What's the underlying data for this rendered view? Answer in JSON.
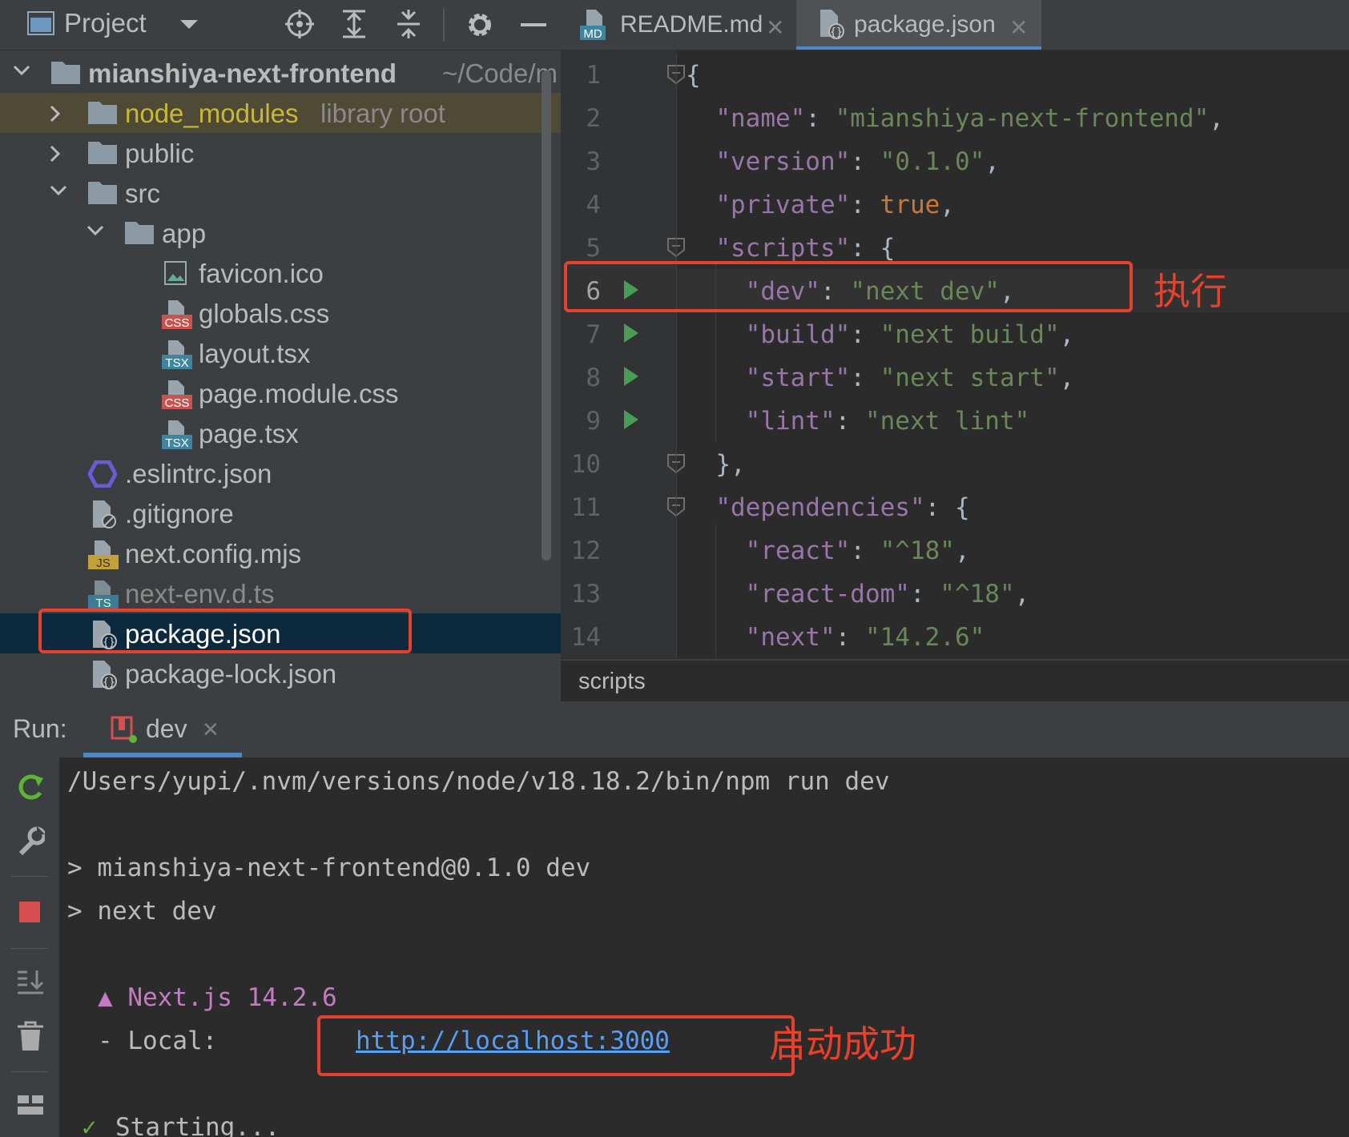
{
  "project_panel": {
    "title": "Project",
    "tree": {
      "root": {
        "label": "mianshiya-next-frontend",
        "path_hint": "~/Code/m"
      },
      "node_modules": {
        "label": "node_modules",
        "suffix": "library root"
      },
      "public": {
        "label": "public"
      },
      "src": {
        "label": "src"
      },
      "app": {
        "label": "app"
      },
      "files": [
        {
          "label": "favicon.ico",
          "badge": ""
        },
        {
          "label": "globals.css",
          "badge": "CSS"
        },
        {
          "label": "layout.tsx",
          "badge": "TSX"
        },
        {
          "label": "page.module.css",
          "badge": "CSS"
        },
        {
          "label": "page.tsx",
          "badge": "TSX"
        }
      ],
      "root_files": [
        {
          "label": ".eslintrc.json",
          "badge": ""
        },
        {
          "label": ".gitignore",
          "badge": ""
        },
        {
          "label": "next.config.mjs",
          "badge": "JS"
        },
        {
          "label": "next-env.d.ts",
          "badge": "TS"
        },
        {
          "label": "package.json",
          "badge": ""
        },
        {
          "label": "package-lock.json",
          "badge": ""
        }
      ]
    }
  },
  "editor": {
    "tabs": [
      {
        "label": "README.md",
        "badge": "MD"
      },
      {
        "label": "package.json",
        "badge": ""
      }
    ],
    "lines": [
      {
        "n": "1",
        "t": [
          "p:{"
        ]
      },
      {
        "n": "2",
        "t": [
          "k:  \"name\"",
          "p:: ",
          "s:\"mianshiya-next-frontend\"",
          "p:,"
        ]
      },
      {
        "n": "3",
        "t": [
          "k:  \"version\"",
          "p:: ",
          "s:\"0.1.0\"",
          "p:,"
        ]
      },
      {
        "n": "4",
        "t": [
          "k:  \"private\"",
          "p:: ",
          "kw:true",
          "p:,"
        ]
      },
      {
        "n": "5",
        "t": [
          "k:  \"scripts\"",
          "p:: {"
        ]
      },
      {
        "n": "6",
        "t": [
          "k:    \"dev\"",
          "p:: ",
          "s:\"next dev\"",
          "p:,"
        ]
      },
      {
        "n": "7",
        "t": [
          "k:    \"build\"",
          "p:: ",
          "s:\"next build\"",
          "p:,"
        ]
      },
      {
        "n": "8",
        "t": [
          "k:    \"start\"",
          "p:: ",
          "s:\"next start\"",
          "p:,"
        ]
      },
      {
        "n": "9",
        "t": [
          "k:    \"lint\"",
          "p:: ",
          "s:\"next lint\""
        ]
      },
      {
        "n": "10",
        "t": [
          "p:  },"
        ]
      },
      {
        "n": "11",
        "t": [
          "k:  \"dependencies\"",
          "p:: {"
        ]
      },
      {
        "n": "12",
        "t": [
          "k:    \"react\"",
          "p:: ",
          "s:\"^18\"",
          "p:,"
        ]
      },
      {
        "n": "13",
        "t": [
          "k:    \"react-dom\"",
          "p:: ",
          "s:\"^18\"",
          "p:,"
        ]
      },
      {
        "n": "14",
        "t": [
          "k:    \"next\"",
          "p:: ",
          "s:\"14.2.6\""
        ]
      }
    ],
    "breadcrumb": "scripts",
    "annotation_exec": "执行"
  },
  "run_panel": {
    "label": "Run:",
    "tab": "dev",
    "console": {
      "cmd": "/Users/yupi/.nvm/versions/node/v18.18.2/bin/npm run dev",
      "line2": "> mianshiya-next-frontend@0.1.0 dev",
      "line3": "> next dev",
      "next_version": "▲ Next.js 14.2.6",
      "local_label": "- Local:",
      "local_url": "http://localhost:3000",
      "starting": "Starting..."
    },
    "annotation_ok": "启动成功"
  },
  "colors": {
    "accent": "#4a88c7",
    "annotation": "#e8412b",
    "link": "#589df6"
  }
}
